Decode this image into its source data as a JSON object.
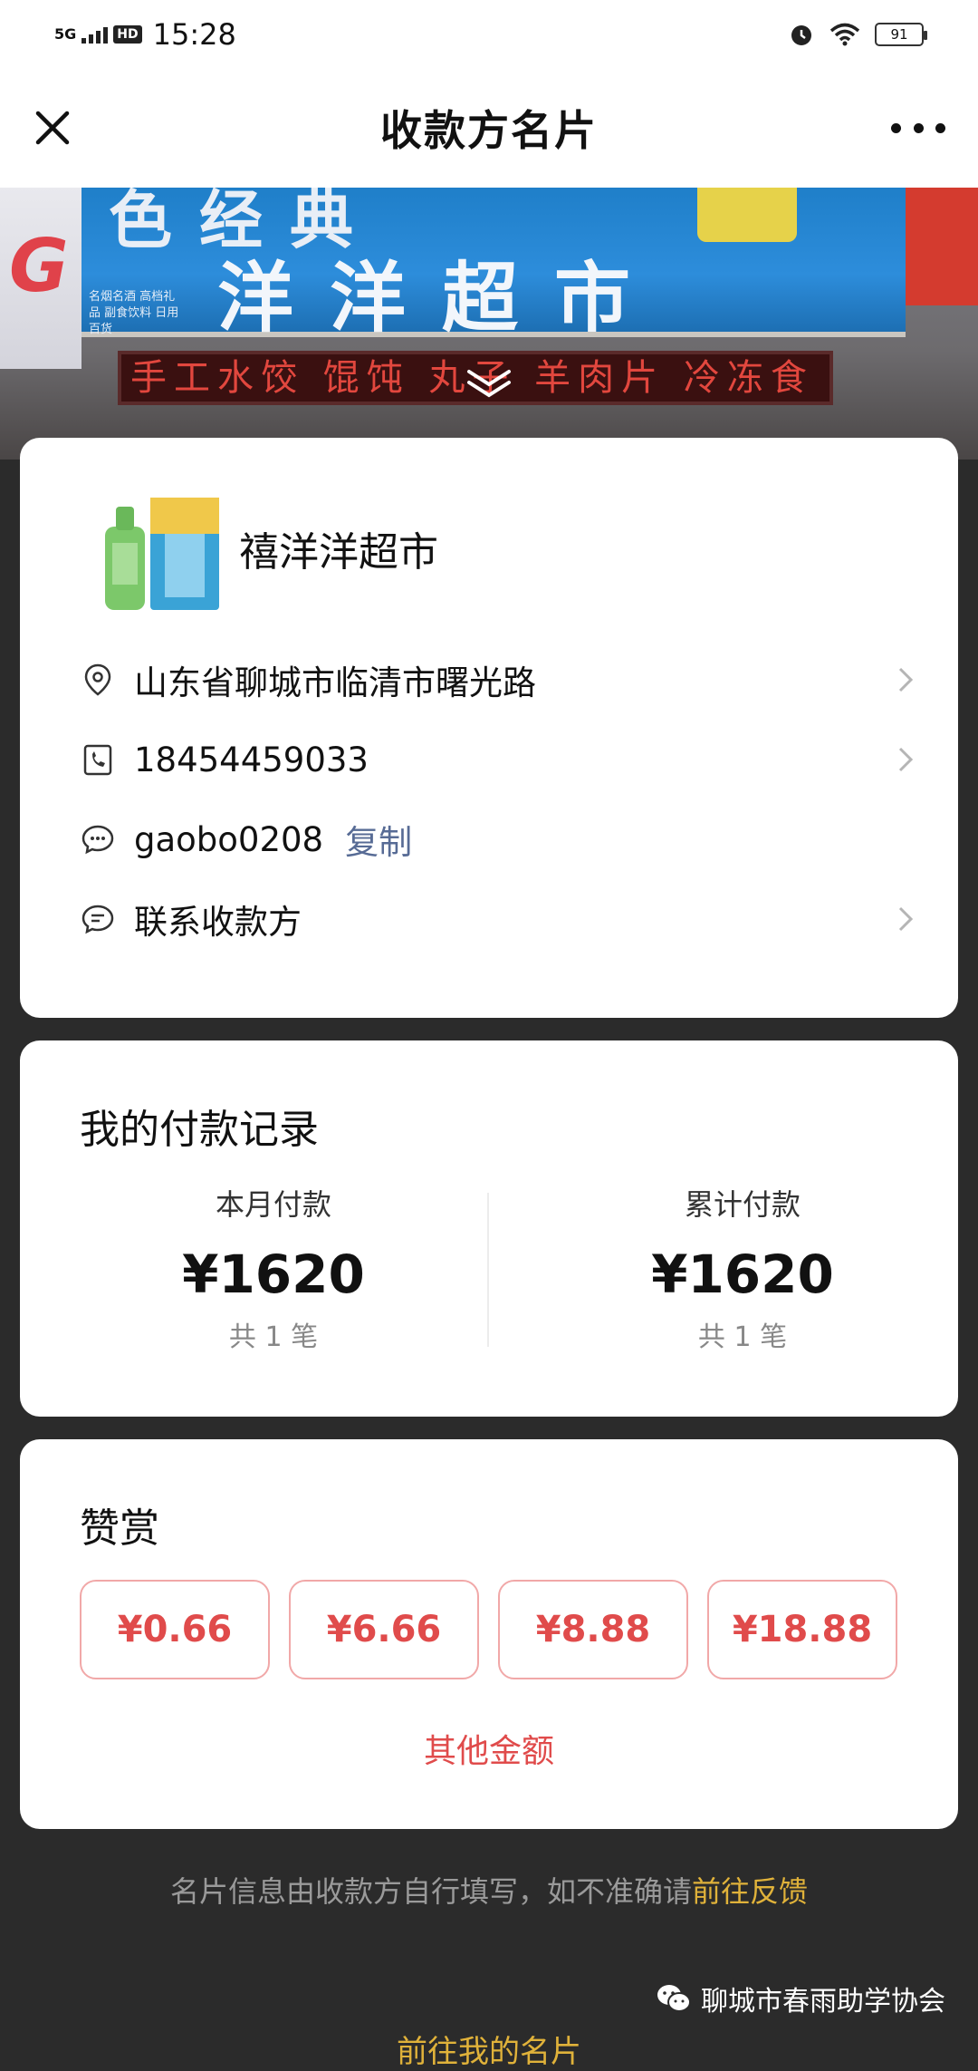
{
  "status_bar": {
    "network": "5G",
    "hd": "HD",
    "time": "15:28",
    "battery": "91"
  },
  "nav": {
    "title": "收款方名片"
  },
  "banner": {
    "sign_text": "洋洋超市",
    "sign_top_text": "色经典",
    "sign_small_text": "名烟名酒 高档礼品 副食饮料 日用百货",
    "led_text": "手工水饺 馄饨 丸子 羊肉片 冷冻食"
  },
  "merchant": {
    "name": "禧洋洋超市",
    "address": "山东省聊城市临清市曙光路",
    "phone": "18454459033",
    "wechat_id": "gaobo0208",
    "copy_label": "复制",
    "contact_label": "联系收款方"
  },
  "payment_record": {
    "title": "我的付款记录",
    "this_month": {
      "label": "本月付款",
      "amount": "¥1620",
      "count": "共 1 笔"
    },
    "total": {
      "label": "累计付款",
      "amount": "¥1620",
      "count": "共 1 笔"
    }
  },
  "reward": {
    "title": "赞赏",
    "options": [
      "¥0.66",
      "¥6.66",
      "¥8.88",
      "¥18.88"
    ],
    "other_label": "其他金额"
  },
  "footer": {
    "note": "名片信息由收款方自行填写，如不准确请",
    "feedback_link": "前往反馈",
    "my_card_link": "前往我的名片",
    "watermark": "聊城市春雨助学协会"
  },
  "colors": {
    "accent_red": "#e04b4b",
    "link_blue": "#576b95",
    "link_gold": "#e0b23a"
  }
}
